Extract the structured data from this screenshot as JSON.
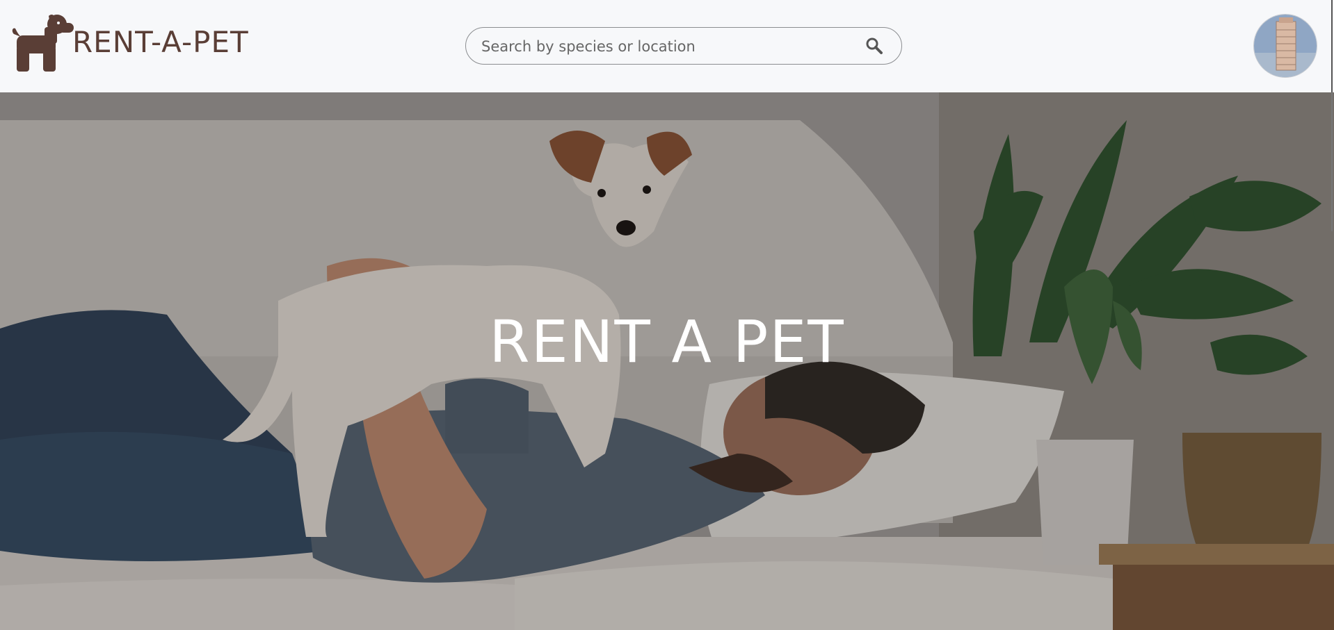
{
  "navbar": {
    "brand_name": "RENT-A-PET",
    "logo_icon": "dog-icon",
    "search": {
      "placeholder": "Search by species or location",
      "value": "",
      "icon": "search-icon"
    },
    "avatar_icon": "avatar"
  },
  "hero": {
    "title": "RENT A PET"
  },
  "colors": {
    "brand_brown": "#5a3e36",
    "navbar_bg": "#f7f8fa",
    "hero_text": "#ffffff"
  }
}
